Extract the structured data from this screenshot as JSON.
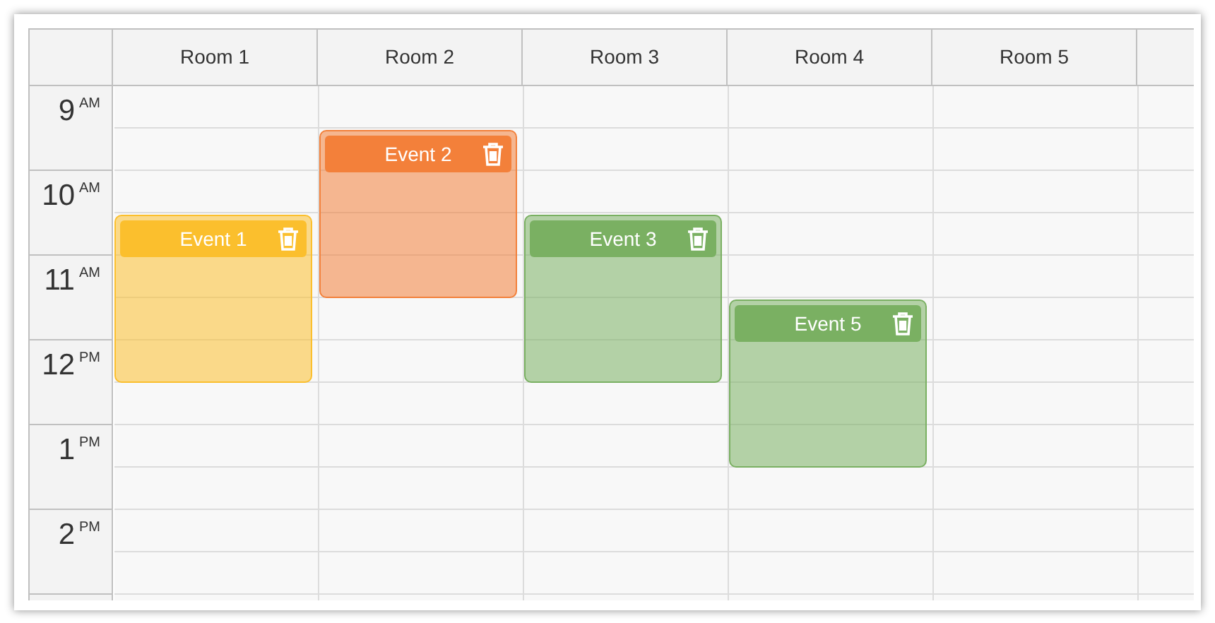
{
  "columns": [
    {
      "label": "Room 1"
    },
    {
      "label": "Room 2"
    },
    {
      "label": "Room 3"
    },
    {
      "label": "Room 4"
    },
    {
      "label": "Room 5"
    }
  ],
  "hours": [
    {
      "hour": "9",
      "meridiem": "AM"
    },
    {
      "hour": "10",
      "meridiem": "AM"
    },
    {
      "hour": "11",
      "meridiem": "AM"
    },
    {
      "hour": "12",
      "meridiem": "PM"
    },
    {
      "hour": "1",
      "meridiem": "PM"
    },
    {
      "hour": "2",
      "meridiem": "PM"
    }
  ],
  "events": [
    {
      "title": "Event 1",
      "color": "#fbbf2d"
    },
    {
      "title": "Event 2",
      "color": "#f3803a"
    },
    {
      "title": "Event 3",
      "color": "#7ab062"
    },
    {
      "title": "Event 5",
      "color": "#7ab062"
    }
  ]
}
